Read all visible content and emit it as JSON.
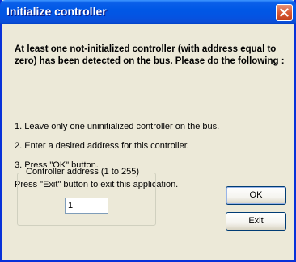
{
  "window": {
    "title": "Initialize controller"
  },
  "message": {
    "intro": "At least one not-initialized controller (with address equal to zero) has been detected on the bus. Please do the following :",
    "steps": [
      "1. Leave only one uninitialized controller on the bus.",
      "2. Enter a desired address for this controller.",
      "3. Press \"OK\" button.",
      "Press \"Exit\" button to exit this application."
    ]
  },
  "address_group": {
    "label": "Controller address (1 to 255)",
    "value": "1"
  },
  "buttons": {
    "ok_label": "OK",
    "exit_label": "Exit"
  },
  "icons": {
    "close": "close-icon"
  },
  "colors": {
    "titlebar": "#0058e6",
    "close_button": "#d85a36",
    "dialog_background": "#ece9d8"
  }
}
